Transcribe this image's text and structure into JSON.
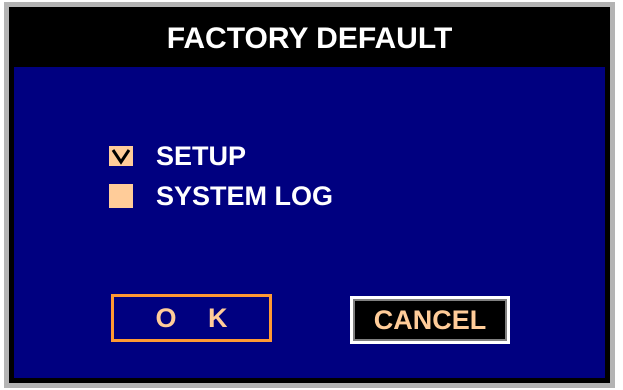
{
  "dialog": {
    "title": "FACTORY DEFAULT"
  },
  "options": [
    {
      "label": "SETUP",
      "checked": true
    },
    {
      "label": "SYSTEM LOG",
      "checked": false
    }
  ],
  "buttons": {
    "ok_label": "O K",
    "cancel_label": "CANCEL"
  },
  "colors": {
    "panel_bg": "#000080",
    "title_bg": "#000000",
    "checkbox_fill": "#ffcc99",
    "ok_border": "#ff9933",
    "button_text": "#ffcc99"
  }
}
